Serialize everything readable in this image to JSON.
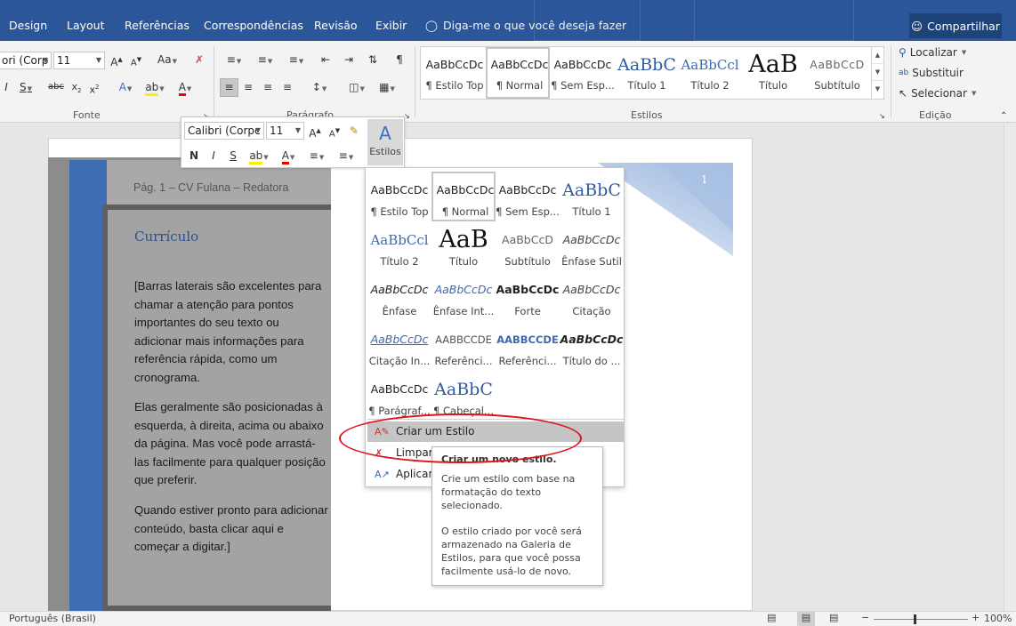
{
  "tabs": [
    "Design",
    "Layout",
    "Referências",
    "Correspondências",
    "Revisão",
    "Exibir"
  ],
  "tell_me": "Diga-me o que você deseja fazer",
  "share_label": "Compartilhar",
  "ribbon": {
    "font_name": "ori (Corp",
    "font_size": "11",
    "group_font": "Fonte",
    "group_paragraph": "Parágrafo",
    "group_styles": "Estilos",
    "group_editing": "Edição",
    "gallery": [
      {
        "sample": "AaBbCcDc",
        "label": "¶ Estilo Top"
      },
      {
        "sample": "AaBbCcDc",
        "label": "¶ Normal"
      },
      {
        "sample": "AaBbCcDc",
        "label": "¶ Sem Esp..."
      },
      {
        "sample": "AaBbC",
        "label": "Título 1"
      },
      {
        "sample": "AaBbCcl",
        "label": "Título 2"
      },
      {
        "sample": "AaB",
        "label": "Título"
      },
      {
        "sample": "AaBbCcD",
        "label": "Subtítulo"
      }
    ],
    "find": "Localizar",
    "replace": "Substituir",
    "select": "Selecionar"
  },
  "mini_toolbar": {
    "font_name": "Calibri (Corpc",
    "font_size": "11",
    "styles_label": "Estilos"
  },
  "document": {
    "header": "Pág. 1 – CV Fulana – Redatora",
    "heading": "Currículo",
    "para1": "[Barras laterais são excelentes para chamar a atenção para pontos importantes do seu texto ou adicionar mais informações para referência rápida, como um cronograma.",
    "para2": "Elas geralmente são posicionadas à esquerda, à direita, acima ou abaixo da página. Mas você pode arrastá-las facilmente para qualquer posição que preferir.",
    "para3": "Quando estiver pronto para adicionar conteúdo, basta clicar aqui e começar a digitar.]",
    "page_number": "1"
  },
  "styles_panel": {
    "items": [
      {
        "sample": "AaBbCcDc",
        "label": "¶ Estilo Top"
      },
      {
        "sample": "AaBbCcDc",
        "label": "¶ Normal"
      },
      {
        "sample": "AaBbCcDc",
        "label": "¶ Sem Esp..."
      },
      {
        "sample": "AaBbC",
        "label": "Título 1"
      },
      {
        "sample": "AaBbCcl",
        "label": "Título 2"
      },
      {
        "sample": "AaB",
        "label": "Título"
      },
      {
        "sample": "AaBbCcD",
        "label": "Subtítulo"
      },
      {
        "sample": "AaBbCcDc",
        "label": "Ênfase Sutil"
      },
      {
        "sample": "AaBbCcDc",
        "label": "Ênfase"
      },
      {
        "sample": "AaBbCcDc",
        "label": "Ênfase Int..."
      },
      {
        "sample": "AaBbCcDc",
        "label": "Forte"
      },
      {
        "sample": "AaBbCcDc",
        "label": "Citação"
      },
      {
        "sample": "AaBbCcDc",
        "label": "Citação In..."
      },
      {
        "sample": "AABBCCDE",
        "label": "Referênci..."
      },
      {
        "sample": "AABBCCDE",
        "label": "Referênci..."
      },
      {
        "sample": "AaBbCcDc",
        "label": "Título do ..."
      },
      {
        "sample": "AaBbCcDc",
        "label": "¶ Parágraf..."
      },
      {
        "sample": "AaBbC",
        "label": "¶ Cabeçal..."
      }
    ],
    "create_style": "Criar um Estilo",
    "clear": "Limpar",
    "apply": "Aplicar"
  },
  "tooltip": {
    "title": "Criar um novo estilo.",
    "p1": "Crie um estilo com base na formatação do texto selecionado.",
    "p2": "O estilo criado por você será armazenado na Galeria de Estilos, para que você possa facilmente usá-lo de novo."
  },
  "status": {
    "language": "Português (Brasil)",
    "zoom": "100%"
  },
  "colors": {
    "accent": "#2b579a",
    "annotation": "#e0141e"
  }
}
